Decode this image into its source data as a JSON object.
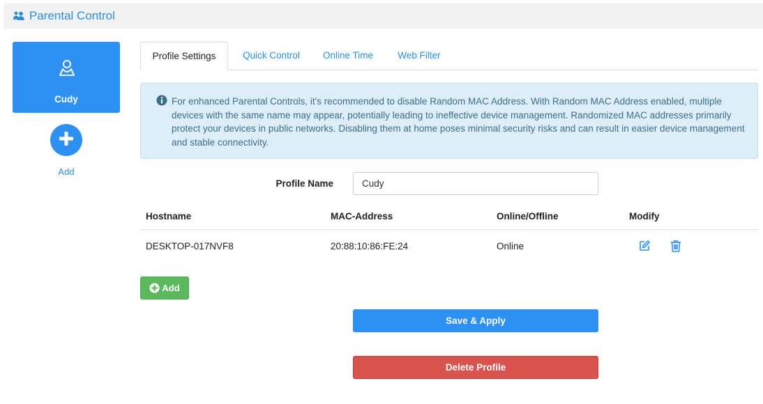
{
  "header": {
    "title": "Parental Control",
    "icon": "users-icon"
  },
  "profiles": {
    "items": [
      {
        "name": "Cudy",
        "icon": "user-profile-icon",
        "active": true
      }
    ],
    "add_label": "Add"
  },
  "tabs": [
    {
      "label": "Profile Settings",
      "active": true
    },
    {
      "label": "Quick Control",
      "active": false
    },
    {
      "label": "Online Time",
      "active": false
    },
    {
      "label": "Web Filter",
      "active": false
    }
  ],
  "alert": {
    "icon": "info-icon",
    "text": "For enhanced Parental Controls, it's recommended to disable Random MAC Address. With Random MAC Address enabled, multiple devices with the same name may appear, potentially leading to ineffective device management. Randomized MAC addresses primarily protect your devices in public networks. Disabling them at home poses minimal security risks and can result in easier device management and stable connectivity."
  },
  "form": {
    "profile_name_label": "Profile Name",
    "profile_name_value": "Cudy"
  },
  "table": {
    "headers": {
      "hostname": "Hostname",
      "mac": "MAC-Address",
      "status": "Online/Offline",
      "modify": "Modify"
    },
    "rows": [
      {
        "hostname": "DESKTOP-017NVF8",
        "mac": "20:88:10:86:FE:24",
        "status": "Online"
      }
    ]
  },
  "buttons": {
    "add_device": "Add",
    "save_apply": "Save & Apply",
    "delete_profile": "Delete Profile"
  },
  "colors": {
    "accent": "#2d91f4",
    "success": "#5cb85c",
    "danger": "#d9534f",
    "info_bg": "#ddeef8",
    "info_text": "#3a6e8a"
  }
}
